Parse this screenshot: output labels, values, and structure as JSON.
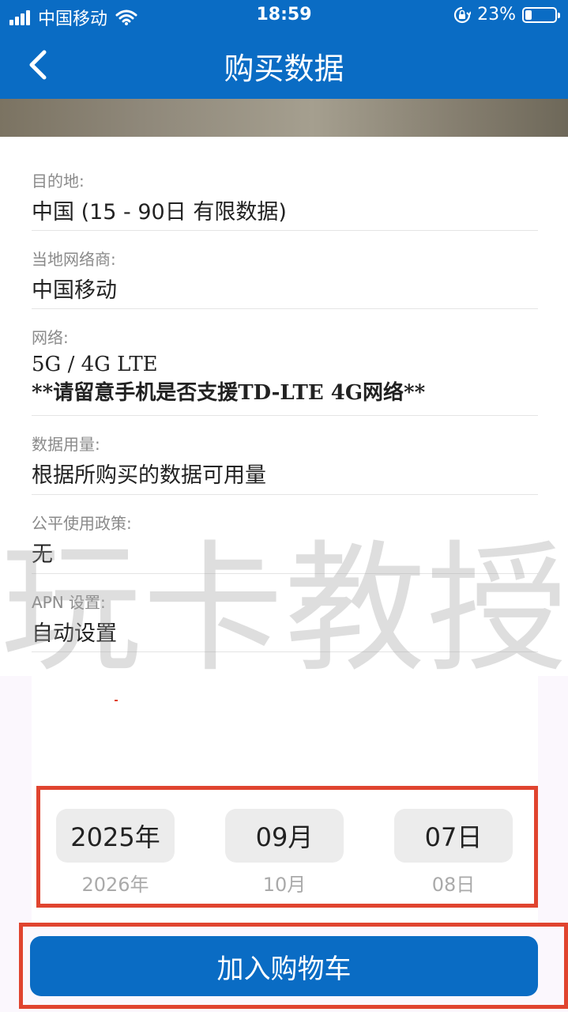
{
  "status_bar": {
    "carrier": "中国移动",
    "time": "18:59",
    "battery_text": "23%",
    "battery_level": 0.23
  },
  "nav": {
    "title": "购买数据"
  },
  "details": [
    {
      "label": "目的地:",
      "value": "中国 (15 - 90日 有限数据)"
    },
    {
      "label": "当地网络商:",
      "value": "中国移动"
    },
    {
      "label": "网络:",
      "value": "5G / 4G LTE",
      "note": "**请留意手机是否支援TD-LTE 4G网络**"
    },
    {
      "label": "数据用量:",
      "value": "根据所购买的数据可用量"
    },
    {
      "label": "公平使用政策:",
      "value": "无"
    },
    {
      "label": "APN 设置:",
      "value": "自动设置"
    }
  ],
  "watermark": [
    "玩",
    "卡",
    "教",
    "授"
  ],
  "date_picker": {
    "year": {
      "selected": "2025年",
      "next": "2026年"
    },
    "month": {
      "selected": "09月",
      "next": "10月"
    },
    "day": {
      "selected": "07日",
      "next": "08日"
    }
  },
  "cart_button_label": "加入购物车",
  "colors": {
    "brand": "#0a6cc4",
    "highlight": "#e0442f"
  }
}
